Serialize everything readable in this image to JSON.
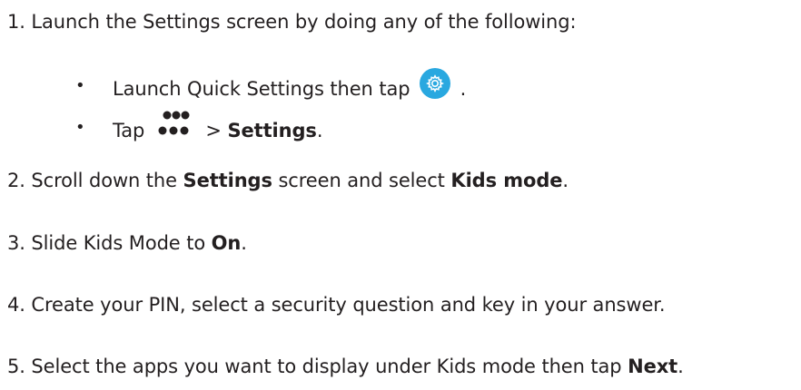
{
  "steps": [
    {
      "number": "1.",
      "text": "Launch the Settings screen by doing any of the following:"
    },
    {
      "number": "2.",
      "pre": "Scroll down the ",
      "bold1": "Settings",
      "mid": " screen and select ",
      "bold2": "Kids mode",
      "post": "."
    },
    {
      "number": "3.",
      "pre": "Slide Kids Mode to ",
      "bold": "On",
      "post": "."
    },
    {
      "number": "4.",
      "text": "Create your PIN, select a security question and key in your answer."
    },
    {
      "number": "5.",
      "pre": "Select the apps you want to display under Kids mode then tap ",
      "bold": "Next",
      "post": "."
    }
  ],
  "substeps": [
    {
      "bullet": "•",
      "pre": "Launch Quick Settings then tap",
      "post": "."
    },
    {
      "bullet": "•",
      "pre": "Tap",
      "mid": "> ",
      "bold": "Settings",
      "post": "."
    }
  ],
  "icons": {
    "gear": "settings-gear-icon",
    "more": "more-dots-icon"
  },
  "colors": {
    "text": "#231f20",
    "gear_background": "#29a8e0"
  }
}
